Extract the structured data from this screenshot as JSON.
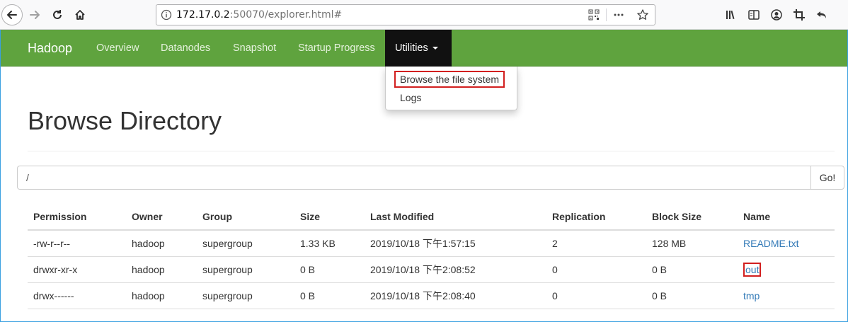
{
  "browser": {
    "url_host": "172.17.0.2",
    "url_path": ":50070/explorer.html#",
    "icons": [
      "back-icon",
      "forward-icon",
      "reload-icon",
      "home-icon",
      "info-icon",
      "qr-code-icon",
      "more-icon",
      "star-icon",
      "library-icon",
      "reader-icon",
      "account-icon",
      "crop-icon",
      "undo-icon"
    ]
  },
  "navbar": {
    "brand": "Hadoop",
    "items": [
      "Overview",
      "Datanodes",
      "Snapshot",
      "Startup Progress"
    ],
    "utilities_label": "Utilities",
    "color": "#5fa33e"
  },
  "dropdown": {
    "items": [
      "Browse the file system",
      "Logs"
    ]
  },
  "main": {
    "title": "Browse Directory",
    "path_value": "/",
    "go_label": "Go!"
  },
  "table": {
    "headers": [
      "Permission",
      "Owner",
      "Group",
      "Size",
      "Last Modified",
      "Replication",
      "Block Size",
      "Name"
    ],
    "rows": [
      [
        "-rw-r--r--",
        "hadoop",
        "supergroup",
        "1.33 KB",
        "2019/10/18 下午1:57:15",
        "2",
        "128 MB",
        "README.txt"
      ],
      [
        "drwxr-xr-x",
        "hadoop",
        "supergroup",
        "0 B",
        "2019/10/18 下午2:08:52",
        "0",
        "0 B",
        "out"
      ],
      [
        "drwx------",
        "hadoop",
        "supergroup",
        "0 B",
        "2019/10/18 下午2:08:40",
        "0",
        "0 B",
        "tmp"
      ]
    ]
  }
}
